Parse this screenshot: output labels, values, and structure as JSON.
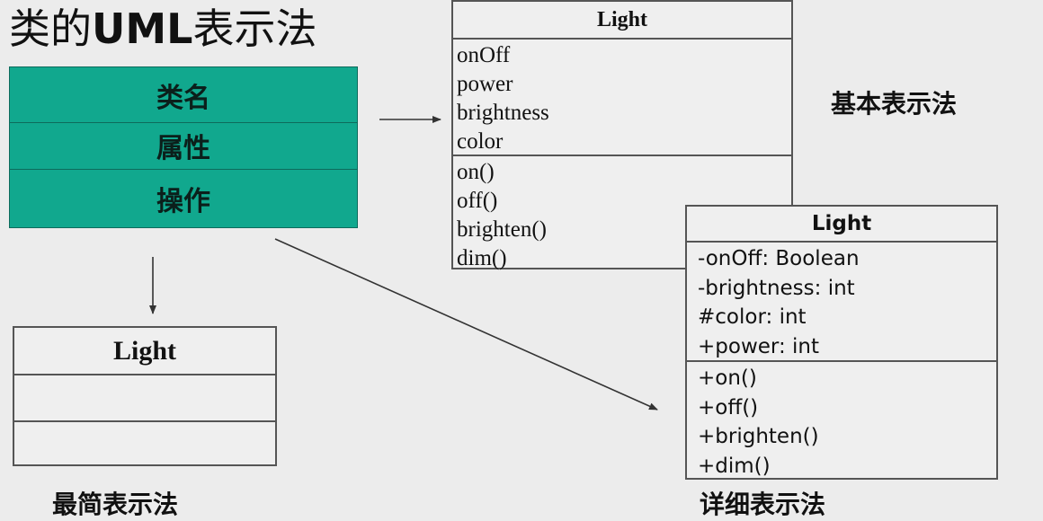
{
  "title": {
    "prefix": "类的",
    "bold": "UML",
    "suffix": "表示法"
  },
  "template": {
    "sections": [
      "类名",
      "属性",
      "操作"
    ]
  },
  "basic": {
    "class_name": "Light",
    "attributes": [
      "onOff",
      "power",
      "brightness",
      "color"
    ],
    "operations": [
      "on()",
      "off()",
      "brighten()",
      "dim()"
    ],
    "caption": "基本表示法"
  },
  "detailed": {
    "class_name": "Light",
    "attributes": [
      "-onOff: Boolean",
      "-brightness: int",
      "#color: int",
      "+power: int"
    ],
    "operations": [
      "+on()",
      "+off()",
      "+brighten()",
      "+dim()"
    ],
    "caption": "详细表示法"
  },
  "minimal": {
    "class_name": "Light",
    "caption": "最简表示法"
  }
}
